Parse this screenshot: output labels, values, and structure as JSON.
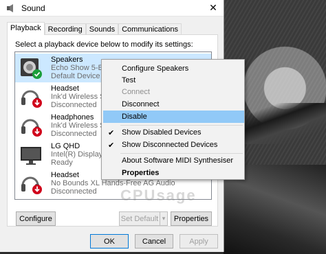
{
  "window": {
    "title": "Sound",
    "close_glyph": "✕"
  },
  "tabs": [
    "Playback",
    "Recording",
    "Sounds",
    "Communications"
  ],
  "instruction": "Select a playback device below to modify its settings:",
  "devices": [
    {
      "name": "Speakers",
      "sub": "Echo Show 5-EG4",
      "status": "Default Device",
      "icon": "speaker-icon",
      "badge": "check"
    },
    {
      "name": "Headset",
      "sub": "Ink'd Wireless Ste",
      "status": "Disconnected",
      "icon": "headset-icon",
      "badge": "down-arrow"
    },
    {
      "name": "Headphones",
      "sub": "Ink'd Wireless Ste",
      "status": "Disconnected",
      "icon": "headphones-icon",
      "badge": "down-arrow"
    },
    {
      "name": "LG QHD",
      "sub": "Intel(R) Display Au",
      "status": "Ready",
      "icon": "monitor-icon",
      "badge": "none"
    },
    {
      "name": "Headset",
      "sub": "No Bounds XL Hands-Free AG Audio",
      "status": "Disconnected",
      "icon": "headset-icon",
      "badge": "down-arrow"
    }
  ],
  "buttons": {
    "configure": "Configure",
    "set_default": "Set Default",
    "properties": "Properties",
    "ok": "OK",
    "cancel": "Cancel",
    "apply": "Apply"
  },
  "context_menu": {
    "items": [
      {
        "label": "Configure Speakers",
        "enabled": true
      },
      {
        "label": "Test",
        "enabled": true
      },
      {
        "label": "Connect",
        "enabled": false
      },
      {
        "label": "Disconnect",
        "enabled": true
      },
      {
        "label": "Disable",
        "enabled": true,
        "highlighted": true
      },
      {
        "label": "Show Disabled Devices",
        "checked": true
      },
      {
        "label": "Show Disconnected Devices",
        "checked": true
      },
      {
        "label": "About Software MIDI Synthesiser",
        "enabled": true
      },
      {
        "label": "Properties",
        "bold": true
      }
    ],
    "check_glyph": "✔"
  },
  "watermark": "CPUsage",
  "colors": {
    "selection": "#cce8ff",
    "menu_highlight": "#91c9f7",
    "check_badge": "#1a9e3a",
    "down_badge": "#d0021b"
  }
}
